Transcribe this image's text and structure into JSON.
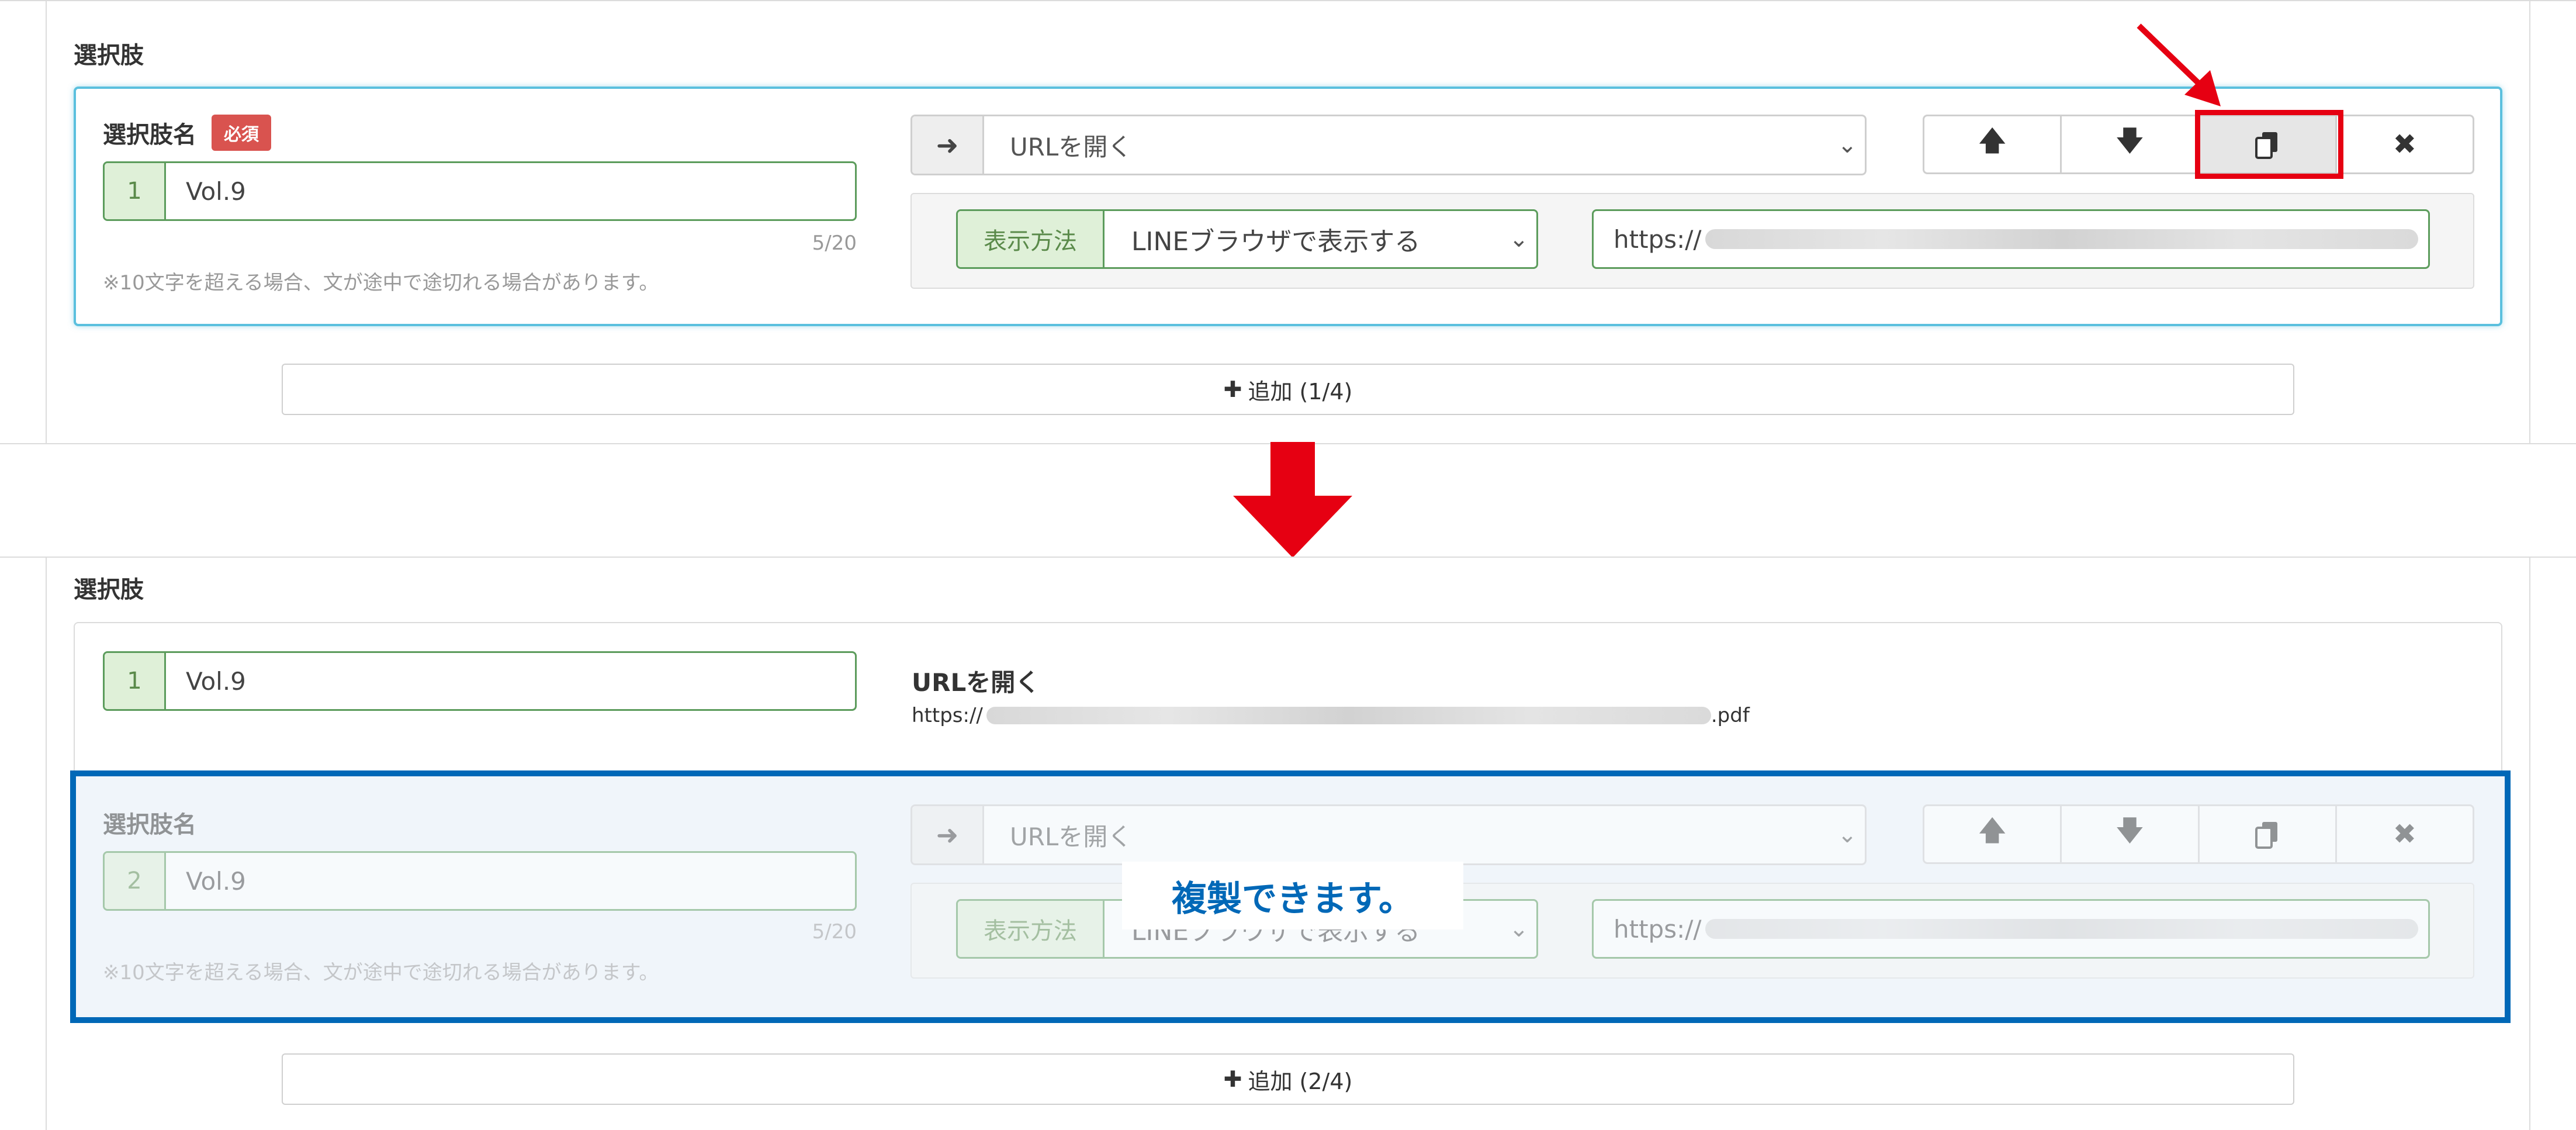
{
  "top": {
    "section_title": "選択肢",
    "choice_label": "選択肢名",
    "required_badge": "必須",
    "index": "1",
    "value": "Vol.9",
    "counter": "5/20",
    "note": "※10文字を超える場合、文が途中で途切れる場合があります。",
    "action_select": "URLを開く",
    "display_label": "表示方法",
    "display_select": "LINEブラウザで表示する",
    "url_prefix": "https://",
    "add_button": "追加 (1/4)"
  },
  "bottom": {
    "section_title": "選択肢",
    "summary": {
      "index": "1",
      "value": "Vol.9",
      "action_title": "URLを開く",
      "url_prefix": "https://",
      "url_suffix": ".pdf"
    },
    "copy": {
      "choice_label": "選択肢名",
      "index": "2",
      "value": "Vol.9",
      "counter": "5/20",
      "note": "※10文字を超える場合、文が途中で途切れる場合があります。",
      "action_select": "URLを開く",
      "display_label": "表示方法",
      "display_select": "LINEブラウザで表示する",
      "url_prefix": "https://"
    },
    "callout": "複製できます。",
    "add_button": "追加 (2/4)"
  },
  "icons": {
    "arrow_right": "arrow-right-icon",
    "up": "arrow-up-icon",
    "down": "arrow-down-icon",
    "copy": "copy-icon",
    "close": "close-icon",
    "plus": "plus-icon",
    "chevron": "chevron-down-icon"
  },
  "colors": {
    "highlight_red": "#e60012",
    "focus_blue": "#5bc0de",
    "copy_frame_blue": "#0068b7",
    "badge_red": "#d9534f",
    "addon_green": "#dff0d8"
  }
}
